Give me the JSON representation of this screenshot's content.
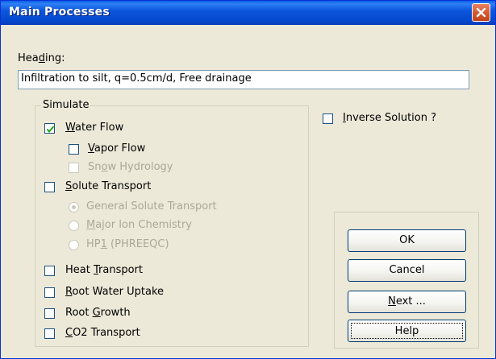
{
  "window": {
    "title": "Main Processes"
  },
  "heading": {
    "label_pre": "Hea",
    "label_ul": "d",
    "label_post": "ing:",
    "value": "Infiltration to silt, q=0.5cm/d, Free drainage"
  },
  "simulate": {
    "title": "Simulate",
    "water_flow": {
      "ul": "W",
      "post": "ater Flow",
      "checked": true
    },
    "vapor_flow": {
      "ul": "V",
      "post": "apor Flow",
      "checked": false
    },
    "snow_hydrology": {
      "pre": "Sn",
      "ul": "o",
      "post": "w Hydrology",
      "checked": false,
      "disabled": true
    },
    "solute_transport": {
      "ul": "S",
      "post": "olute Transport",
      "checked": false
    },
    "general_solute": {
      "label": "General Solute Transport",
      "selected": true,
      "disabled": true
    },
    "major_ion": {
      "ul": "M",
      "post": "ajor Ion Chemistry",
      "selected": false,
      "disabled": true
    },
    "hp1": {
      "pre": "HP",
      "ul": "1",
      "post": " (PHREEQC)",
      "selected": false,
      "disabled": true
    },
    "heat_transport": {
      "pre": "Heat ",
      "ul": "T",
      "post": "ransport",
      "checked": false
    },
    "root_water_uptake": {
      "ul": "R",
      "post": "oot Water Uptake",
      "checked": false
    },
    "root_growth": {
      "pre": "Root ",
      "ul": "G",
      "post": "rowth",
      "checked": false
    },
    "co2_transport": {
      "ul": "C",
      "post": "O2 Transport",
      "checked": false
    }
  },
  "inverse": {
    "ul": "I",
    "post": "nverse Solution ?",
    "checked": false
  },
  "buttons": {
    "ok": "OK",
    "cancel": "Cancel",
    "next_ul": "N",
    "next_post": "ext ...",
    "help": "Help"
  },
  "colors": {
    "titlebar": "#0449d0",
    "dialog_bg": "#ece9d8",
    "close": "#d85a34",
    "disabled_text": "#aca899"
  }
}
